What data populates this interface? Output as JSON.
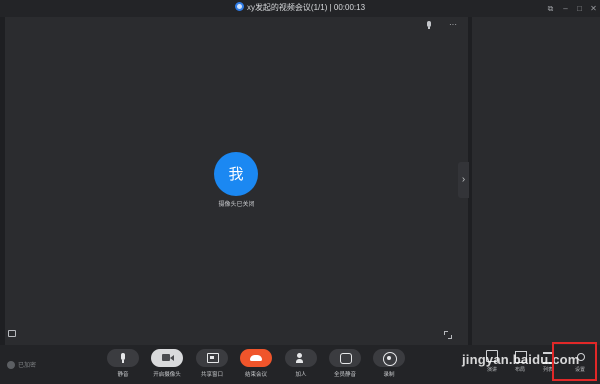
{
  "window": {
    "title": "xy发起的视频会议(1/1) | 00:00:13",
    "controls": [
      "restore-icon",
      "minimize-icon",
      "maximize-icon",
      "close-icon"
    ]
  },
  "video": {
    "avatar_text": "我",
    "camera_status": "摄像头已关闭",
    "top_tools": [
      "mic-icon",
      "more-icon"
    ],
    "more_label": "···",
    "accent_color": "#1b88f2"
  },
  "panel_toggle": {
    "icon": "chevron-right-icon",
    "glyph": "›"
  },
  "toolbar": {
    "secure_label": "已加密",
    "items": [
      {
        "label": "静音",
        "icon": "mic-icon"
      },
      {
        "label": "开启摄像头",
        "icon": "camera-icon"
      },
      {
        "label": "共享窗口",
        "icon": "share-window-icon"
      },
      {
        "label": "结束会议",
        "icon": "hangup-icon",
        "color": "#f0552b"
      },
      {
        "label": "加人",
        "icon": "add-person-icon"
      },
      {
        "label": "全员静音",
        "icon": "mute-all-icon"
      },
      {
        "label": "录制",
        "icon": "record-icon"
      }
    ],
    "right_items": [
      {
        "label": "演讲",
        "icon": "speaker-view-icon"
      },
      {
        "label": "布局",
        "icon": "layout-icon"
      },
      {
        "label": "列表",
        "icon": "list-icon"
      },
      {
        "label": "设置",
        "icon": "gear-icon"
      }
    ]
  },
  "watermark": "jingyan.baidu.com"
}
